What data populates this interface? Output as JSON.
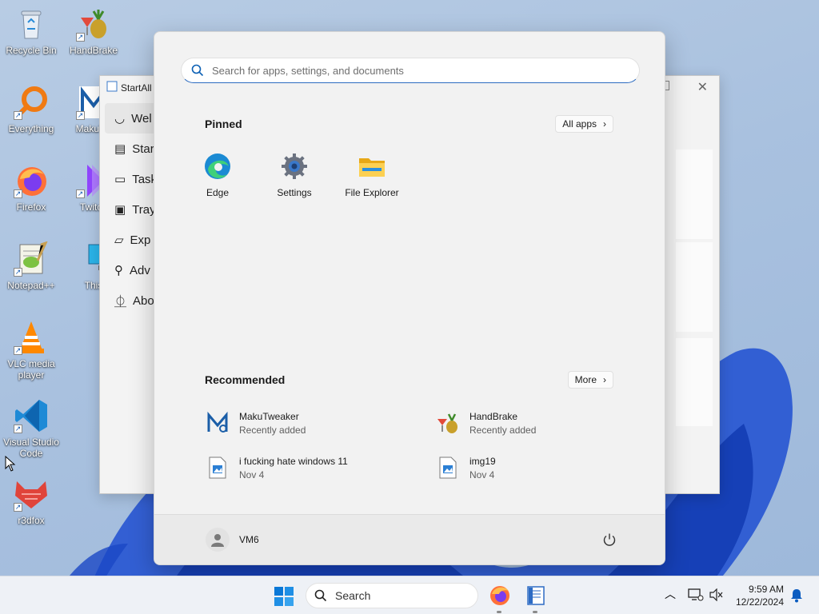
{
  "desktop": {
    "icons": [
      {
        "label": "Recycle Bin",
        "icon": "recycle-bin-icon"
      },
      {
        "label": "HandBrake",
        "icon": "handbrake-icon"
      },
      {
        "label": "Everything",
        "icon": "everything-icon"
      },
      {
        "label": "MakuTw",
        "icon": "makutweaker-icon"
      },
      {
        "label": "Firefox",
        "icon": "firefox-icon"
      },
      {
        "label": "Twitch",
        "icon": "twitch-icon"
      },
      {
        "label": "Notepad++",
        "icon": "notepadpp-icon"
      },
      {
        "label": "This",
        "icon": "this-pc-icon"
      },
      {
        "label": "VLC media player",
        "icon": "vlc-icon"
      },
      {
        "label": "Visual Studio Code",
        "icon": "vscode-icon"
      },
      {
        "label": "r3dfox",
        "icon": "r3dfox-icon"
      }
    ]
  },
  "bg_window": {
    "title": "StartAll",
    "nav": [
      {
        "label": "Wel",
        "icon": "smile-icon"
      },
      {
        "label": "Star",
        "icon": "start-menu-icon"
      },
      {
        "label": "Task",
        "icon": "taskbar-icon"
      },
      {
        "label": "Tray",
        "icon": "tray-icon"
      },
      {
        "label": "Exp",
        "icon": "folder-icon"
      },
      {
        "label": "Adv",
        "icon": "wrench-icon"
      },
      {
        "label": "Abo",
        "icon": "about-icon"
      }
    ]
  },
  "start_menu": {
    "search_placeholder": "Search for apps, settings, and documents",
    "pinned_title": "Pinned",
    "all_apps_label": "All apps",
    "pinned": [
      {
        "label": "Edge",
        "icon": "edge-icon"
      },
      {
        "label": "Settings",
        "icon": "settings-gear-icon"
      },
      {
        "label": "File Explorer",
        "icon": "file-explorer-icon"
      }
    ],
    "recommended_title": "Recommended",
    "more_label": "More",
    "recommended": [
      {
        "name": "MakuTweaker",
        "sub": "Recently added",
        "icon": "makutweaker-icon"
      },
      {
        "name": "HandBrake",
        "sub": "Recently added",
        "icon": "handbrake-icon"
      },
      {
        "name": "i fucking hate windows 11",
        "sub": "Nov 4",
        "icon": "image-file-icon"
      },
      {
        "name": "img19",
        "sub": "Nov 4",
        "icon": "image-file-icon"
      }
    ],
    "user_name": "VM6"
  },
  "taskbar": {
    "search_label": "Search",
    "time": "9:59 AM",
    "date": "12/22/2024"
  },
  "colors": {
    "accent": "#0067c0",
    "wallpaper": "#a9c1df"
  }
}
